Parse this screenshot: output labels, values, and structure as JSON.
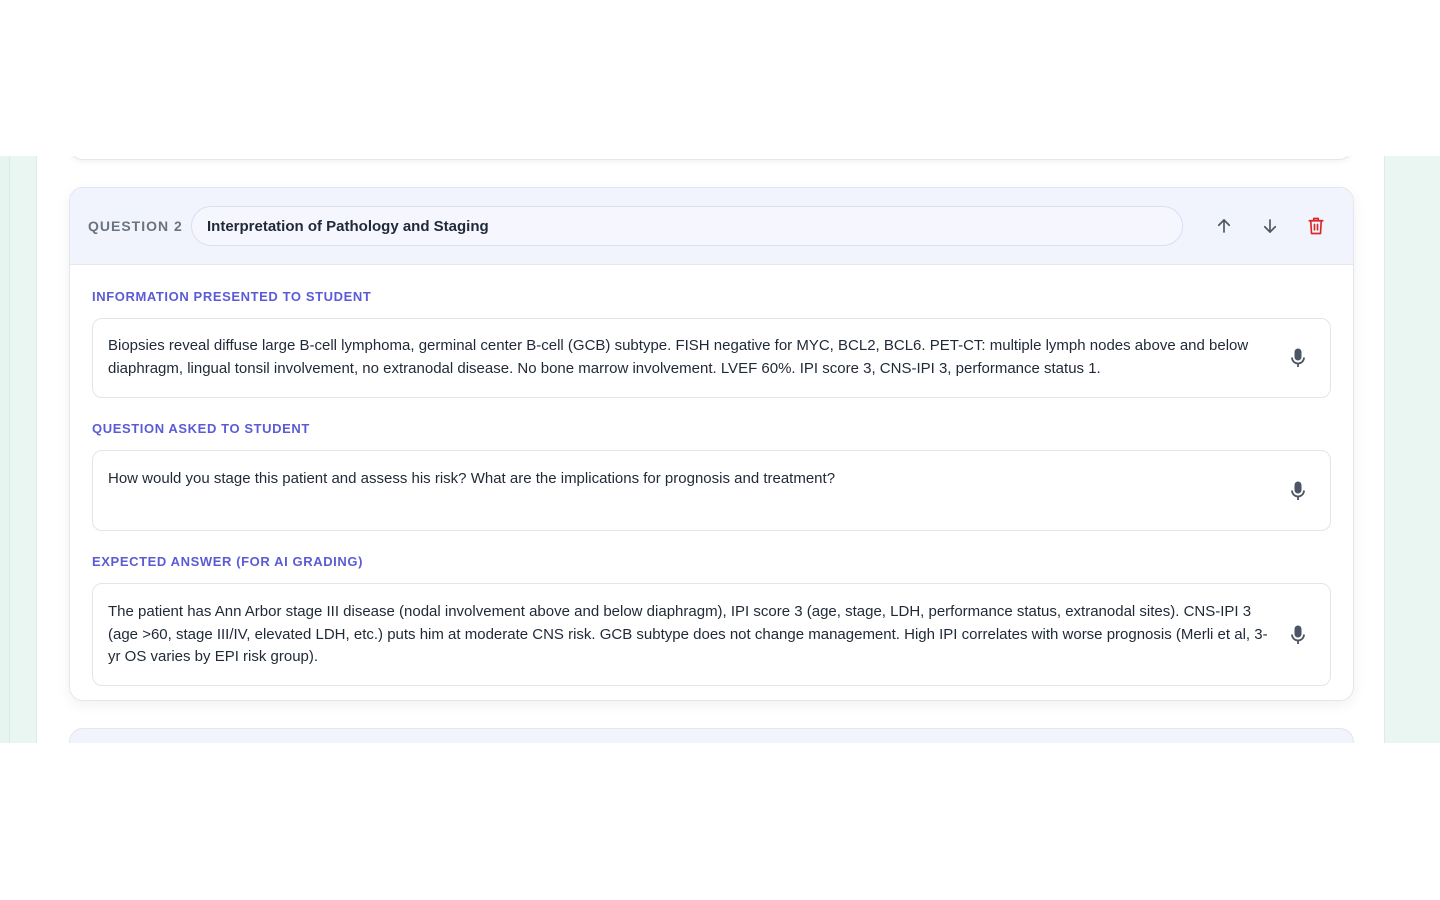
{
  "question": {
    "label": "QUESTION 2",
    "title": "Interpretation of Pathology and Staging"
  },
  "sections": {
    "information": {
      "label": "INFORMATION PRESENTED TO STUDENT",
      "text": "Biopsies reveal diffuse large B-cell lymphoma, germinal center B-cell (GCB) subtype. FISH negative for MYC, BCL2, BCL6. PET-CT: multiple lymph nodes above and below diaphragm, lingual tonsil involvement, no extranodal disease. No bone marrow involvement. LVEF 60%. IPI score 3, CNS-IPI 3, performance status 1."
    },
    "question_asked": {
      "label": "QUESTION ASKED TO STUDENT",
      "text": "How would you stage this patient and assess his risk? What are the implications for prognosis and treatment?"
    },
    "expected_answer": {
      "label": "EXPECTED ANSWER (FOR AI GRADING)",
      "text": "The patient has Ann Arbor stage III disease (nodal involvement above and below diaphragm), IPI score 3 (age, stage, LDH, performance status, extranodal sites). CNS-IPI 3 (age >60, stage III/IV, elevated LDH, etc.) puts him at moderate CNS risk. GCB subtype does not change management. High IPI correlates with worse prognosis (Merli et al, 3-yr OS varies by EPI risk group)."
    }
  },
  "icons": {
    "move_up": "arrow-up-icon",
    "move_down": "arrow-down-icon",
    "delete": "trash-icon",
    "dictate": "microphone-icon"
  },
  "colors": {
    "accent": "#5b5bd6",
    "delete": "#dc2626",
    "header_bg": "#f2f4fd",
    "page_bg": "#eaf6f2"
  }
}
